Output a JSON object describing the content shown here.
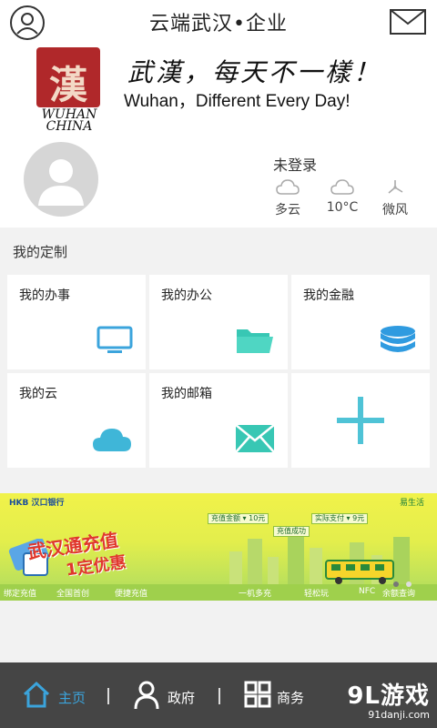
{
  "header": {
    "title": "云端武汉•企业",
    "user_icon": "user-icon",
    "mail_icon": "mail-icon"
  },
  "brand": {
    "seal_char": "漢",
    "logo_text_1": "WUHAN",
    "logo_text_2": "CHINA",
    "slogan_cn": "武漢，每天不一樣！",
    "slogan_en": "Wuhan，Different Every Day!"
  },
  "profile": {
    "login_status": "未登录",
    "weather": [
      {
        "icon": "cloud-icon",
        "label": "多云"
      },
      {
        "icon": "cloud-icon",
        "label": "10°C"
      },
      {
        "icon": "wind-icon",
        "label": "微风"
      }
    ]
  },
  "custom": {
    "title": "我的定制",
    "tiles": [
      {
        "label": "我的办事",
        "icon": "monitor-icon"
      },
      {
        "label": "我的办公",
        "icon": "folder-icon"
      },
      {
        "label": "我的金融",
        "icon": "coins-icon"
      },
      {
        "label": "我的云",
        "icon": "cloud-icon"
      },
      {
        "label": "我的邮箱",
        "icon": "envelope-icon"
      },
      {
        "label": "",
        "icon": "plus-icon"
      }
    ]
  },
  "ad": {
    "bank": "HKB 汉口银行",
    "wallet": "易生活",
    "headline_1": "武汉通充值",
    "headline_2": "1定优惠",
    "field_1": "充值金额 ▾ 10元",
    "field_2": "实际支付 ▾ 9元",
    "field_3": "充值成功",
    "chips": [
      "绑定充值",
      "全国首创",
      "便捷充值",
      "一机多充",
      "轻松玩",
      "NFC",
      "余额查询"
    ]
  },
  "tabbar": {
    "items": [
      {
        "label": "主页",
        "icon": "home-icon"
      },
      {
        "label": "政府",
        "icon": "person-icon"
      },
      {
        "label": "商务",
        "icon": "grid-icon"
      }
    ],
    "watermark_1": "9L游戏",
    "watermark_2": "91danji.com"
  },
  "colors": {
    "accent": "#3ba4dc",
    "icon_cyan": "#4fc3d6",
    "tabbar_bg": "#454545",
    "active_tab": "#3ba4dc"
  }
}
